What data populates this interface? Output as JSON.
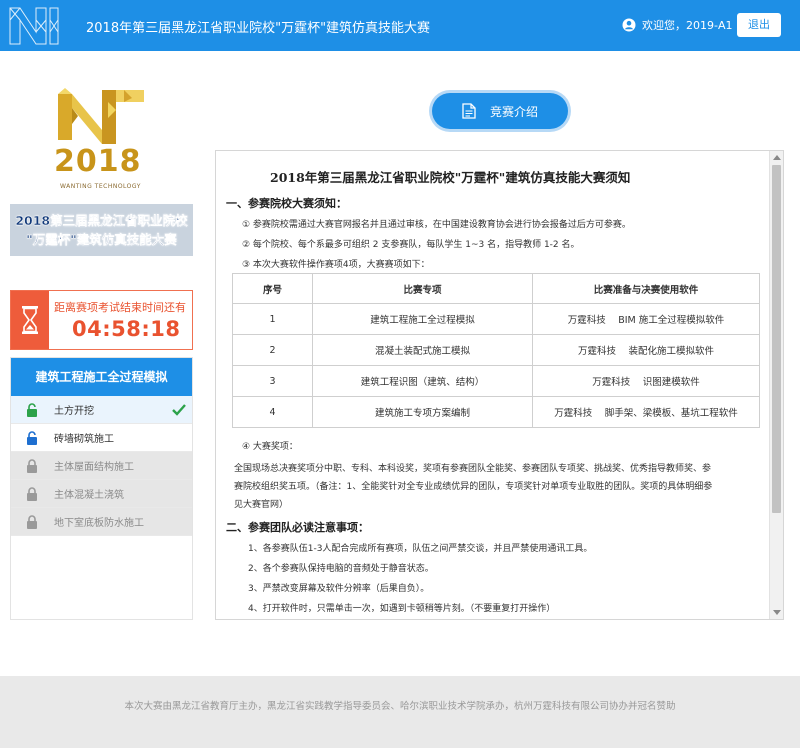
{
  "header": {
    "title": "2018年第三届黑龙江省职业院校\"万霆杯\"建筑仿真技能大赛",
    "welcome": "欢迎您，2019-A1",
    "logout_label": "退出"
  },
  "sidebar": {
    "brand_year": "2018",
    "brand_sub": "WANTING TECHNOLOGY",
    "banner_line1": "2018第三届黑龙江省职业院校",
    "banner_line2": "\"万霆杯\"建筑仿真技能大赛",
    "timer_label": "距离赛项考试结束时间还有",
    "timer_value": "04:58:18",
    "task_header": "建筑工程施工全过程模拟",
    "tasks": [
      {
        "label": "土方开挖"
      },
      {
        "label": "砖墙砌筑施工"
      },
      {
        "label": "主体屋面结构施工"
      },
      {
        "label": "主体混凝土浇筑"
      },
      {
        "label": "地下室底板防水施工"
      }
    ]
  },
  "tab": {
    "label": "竞赛介绍"
  },
  "doc": {
    "title": "2018年第三届黑龙江省职业院校\"万霆杯\"建筑仿真技能大赛须知",
    "sec1": "一、参赛院校大赛须知：",
    "p1": "① 参赛院校需通过大赛官网报名并且通过审核，在中国建设教育协会进行协会报备过后方可参赛。",
    "p2": "② 每个院校、每个系最多可组织 2 支参赛队，每队学生 1~3 名，指导教师 1-2 名。",
    "p3": "③ 本次大赛软件操作赛项4项，大赛赛项如下：",
    "table": {
      "headers": [
        "序号",
        "比赛专项",
        "比赛准备与决赛使用软件"
      ],
      "rows": [
        [
          "1",
          "建筑工程施工全过程模拟",
          "万霆科技　 BIM 施工全过程模拟软件"
        ],
        [
          "2",
          "混凝土装配式施工模拟",
          "万霆科技　 装配化施工模拟软件"
        ],
        [
          "3",
          "建筑工程识图（建筑、结构）",
          "万霆科技　 识图建模软件"
        ],
        [
          "4",
          "建筑施工专项方案编制",
          "万霆科技　 脚手架、梁模板、基坑工程软件"
        ]
      ]
    },
    "p4": "④ 大赛奖项：",
    "p5": "全国现场总决赛奖项分中职、专科、本科设奖，奖项有参赛团队全能奖、参赛团队专项奖、挑战奖、优秀指导教师奖、参",
    "p6": "赛院校组织奖五项。（备注：1、全能奖针对全专业成绩优异的团队，专项奖针对单项专业取胜的团队。奖项的具体明细参",
    "p7": "见大赛官网）",
    "sec2": "二、参赛团队必读注意事项：",
    "n1": "1、各参赛队伍1-3人配合完成所有赛项，队伍之间严禁交谈，并且严禁使用通讯工具。",
    "n2": "2、各个参赛队保持电脑的音频处于静音状态。",
    "n3": "3、严禁改变屏幕及软件分辨率（后果自负）。",
    "n4": "4、打开软件时，只需单击一次，如遇到卡顿稍等片刻。（不要重复打开操作）"
  },
  "footer": {
    "text": "本次大赛由黑龙江省教育厅主办，黑龙江省实践教学指导委员会、哈尔滨职业技术学院承办，杭州万霆科技有限公司协办并冠名赞助"
  }
}
